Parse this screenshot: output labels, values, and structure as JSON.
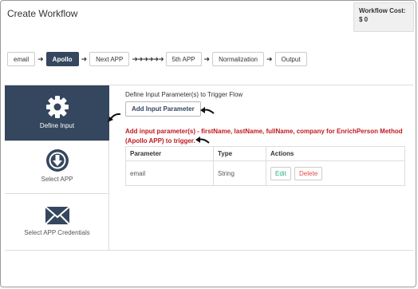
{
  "header": {
    "title": "Create Workflow",
    "workflow_cost": "Workflow Cost: $ 0"
  },
  "pipeline": {
    "steps": [
      "email",
      "Apollo",
      "Next APP",
      "5th APP",
      "Normalization",
      "Output"
    ],
    "active_step": "Apollo",
    "arrow_glyph": "➜",
    "arrow_chain": "➜➜➜➜➜➜"
  },
  "sidebar": {
    "items": [
      {
        "label": "Define Input",
        "icon": "gear-icon",
        "active": true
      },
      {
        "label": "Select APP",
        "icon": "download-circle-icon",
        "active": false
      },
      {
        "label": "Select APP Credentials",
        "icon": "envelope-icon",
        "active": false
      }
    ]
  },
  "main": {
    "define_text": "Define Input Parameter(s) to Trigger Flow",
    "add_button": "Add Input Parameter",
    "hint": "Add input parameter(s) - firstName, lastName, fullName, company for EnrichPerson Method (Apollo APP) to trigger.",
    "table": {
      "headers": [
        "Parameter",
        "Type",
        "Actions"
      ],
      "rows": [
        {
          "parameter": "email",
          "type": "String",
          "edit": "Edit",
          "delete": "Delete"
        }
      ]
    }
  },
  "colors": {
    "accent": "#34475e",
    "hint": "#c0181e",
    "edit": "#2bb08a",
    "delete": "#e64a4a"
  }
}
